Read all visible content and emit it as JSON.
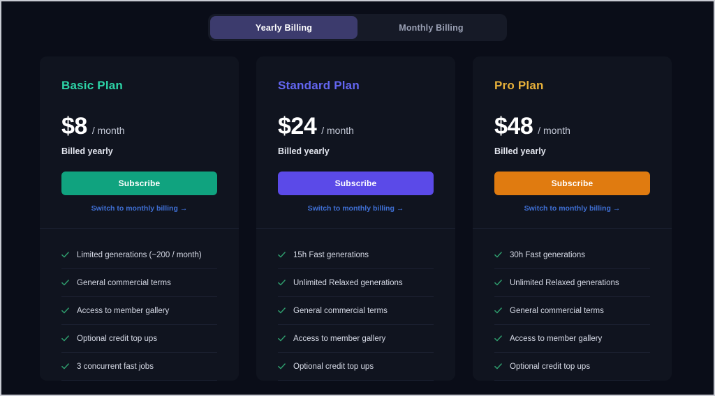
{
  "billing_toggle": {
    "options": [
      {
        "label": "Yearly Billing",
        "active": true
      },
      {
        "label": "Monthly Billing",
        "active": false
      }
    ]
  },
  "colors": {
    "page_background": "#0a0d18",
    "card_background": "#10141f",
    "divider": "#1b2030",
    "toggle_track": "#161a27",
    "toggle_active": "#3c3b6d",
    "check_green": "#2f9e6e",
    "link_blue": "#3f6fd4",
    "basic_accent": "#2dd4a7",
    "standard_accent": "#6366f1",
    "pro_accent": "#e8b13a"
  },
  "plans": [
    {
      "name": "Basic Plan",
      "accent": "#2dd4a7",
      "price": "$8",
      "period": "/ month",
      "billed": "Billed yearly",
      "button_label": "Subscribe",
      "button_color": "#10a37f",
      "switch_label": "Switch to monthly billing",
      "switch_arrow": "→",
      "features": [
        "Limited generations (~200 / month)",
        "General commercial terms",
        "Access to member gallery",
        "Optional credit top ups",
        "3 concurrent fast jobs"
      ]
    },
    {
      "name": "Standard Plan",
      "accent": "#6366f1",
      "price": "$24",
      "period": "/ month",
      "billed": "Billed yearly",
      "button_label": "Subscribe",
      "button_color": "#5b4ae8",
      "switch_label": "Switch to monthly billing",
      "switch_arrow": "→",
      "features": [
        "15h Fast generations",
        "Unlimited Relaxed generations",
        "General commercial terms",
        "Access to member gallery",
        "Optional credit top ups"
      ]
    },
    {
      "name": "Pro Plan",
      "accent": "#e8b13a",
      "price": "$48",
      "period": "/ month",
      "billed": "Billed yearly",
      "button_label": "Subscribe",
      "button_color": "#e07b10",
      "switch_label": "Switch to monthly billing",
      "switch_arrow": "→",
      "features": [
        "30h Fast generations",
        "Unlimited Relaxed generations",
        "General commercial terms",
        "Access to member gallery",
        "Optional credit top ups"
      ]
    }
  ]
}
